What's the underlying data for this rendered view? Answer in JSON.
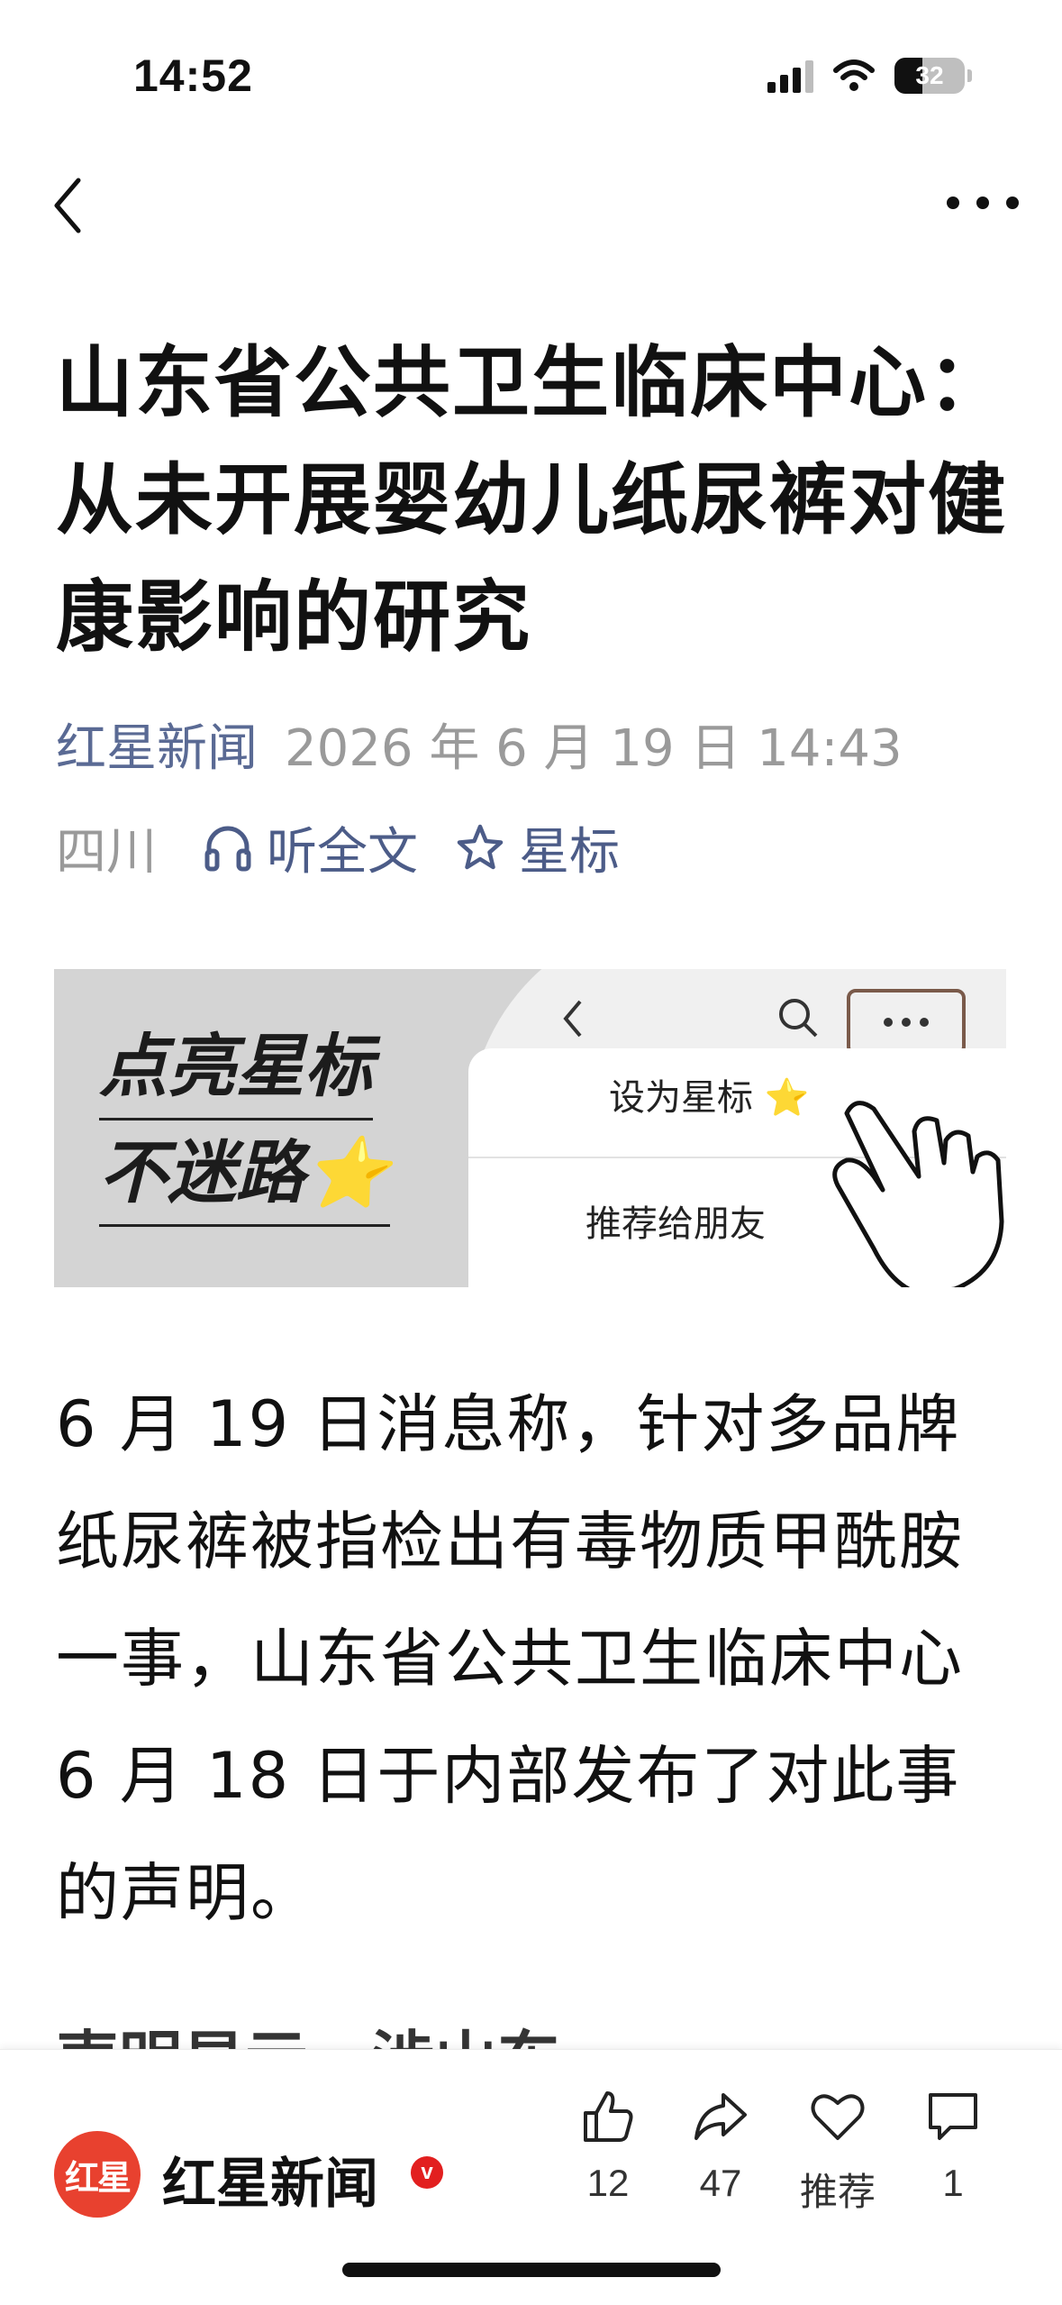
{
  "status_bar": {
    "time": "14:52",
    "battery_level": "32"
  },
  "article": {
    "title": "山东省公共卫生临床中心：从未开展婴幼儿纸尿裤对健康影响的研究",
    "source": "红星新闻",
    "publish_time": "2026 年 6 月 19 日 14:43",
    "region": "四川",
    "listen_label": "听全文",
    "star_label": "星标",
    "body": "6 月 19 日消息称，针对多品牌纸尿裤被指检出有毒物质甲酰胺一事，山东省公共卫生临床中心 6 月 18 日于内部发布了对此事的声明。",
    "partial_next_line": "声明显示，涉山东...."
  },
  "banner": {
    "line1": "点亮星标",
    "line2": "不迷路⭐",
    "menu_item1": "设为星标 ⭐",
    "menu_item2": "推荐给朋友"
  },
  "bottom_bar": {
    "source_logo_text": "红星",
    "source_name": "红星新闻",
    "verified_mark": "v",
    "like_count": "12",
    "share_count": "47",
    "recommend_label": "推荐",
    "comment_count": "1"
  },
  "colors": {
    "source_blue": "#5a6a94",
    "meta_gray": "#9a9a9a",
    "logo_red": "#e8412f"
  }
}
